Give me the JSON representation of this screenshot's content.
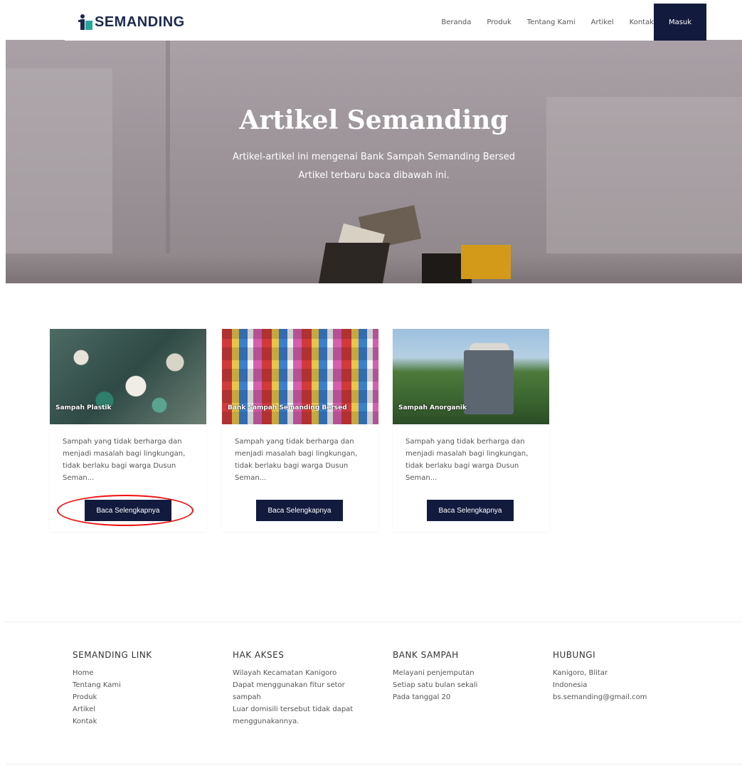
{
  "brand": {
    "name": "SEMANDING",
    "logo_icon": "person-icon"
  },
  "nav": {
    "items": [
      "Beranda",
      "Produk",
      "Tentang Kami",
      "Artikel",
      "Kontak"
    ],
    "login_label": "Masuk",
    "accent": "#121b3e"
  },
  "hero": {
    "title": "Artikel Semanding",
    "subtitle_line1": "Artikel-artikel ini mengenai Bank Sampah Semanding Bersed",
    "subtitle_line2": "Artikel terbaru baca dibawah ini."
  },
  "articles": [
    {
      "caption": "Sampah Plastik",
      "excerpt": "Sampah yang tidak berharga dan menjadi masalah bagi lingkungan, tidak berlaku bagi warga Dusun Seman...",
      "button": "Baca Selengkapnya"
    },
    {
      "caption": "Bank Sampah Semanding Bersed",
      "excerpt": "Sampah yang tidak berharga dan menjadi masalah bagi lingkungan, tidak berlaku bagi warga Dusun Seman...",
      "button": "Baca Selengkapnya"
    },
    {
      "caption": "Sampah Anorganik",
      "excerpt": "Sampah yang tidak berharga dan menjadi masalah bagi lingkungan, tidak berlaku bagi warga Dusun Seman...",
      "button": "Baca Selengkapnya"
    }
  ],
  "footer": {
    "col1": {
      "title": "SEMANDING LINK",
      "items": [
        "Home",
        "Tentang Kami",
        "Produk",
        "Artikel",
        "Kontak"
      ]
    },
    "col2": {
      "title": "HAK AKSES",
      "items": [
        "Wilayah Kecamatan Kanigoro",
        "Dapat menggunakan fitur setor",
        "sampah",
        "Luar domisili tersebut tidak dapat",
        "menggunakannya."
      ]
    },
    "col3": {
      "title": "BANK SAMPAH",
      "items": [
        "Melayani penjemputan",
        "Setiap satu bulan sekali",
        "Pada tanggal 20"
      ]
    },
    "col4": {
      "title": "HUBUNGI",
      "items": [
        "Kanigoro, Blitar",
        "Indonesia",
        "bs.semanding@gmail.com"
      ]
    }
  }
}
